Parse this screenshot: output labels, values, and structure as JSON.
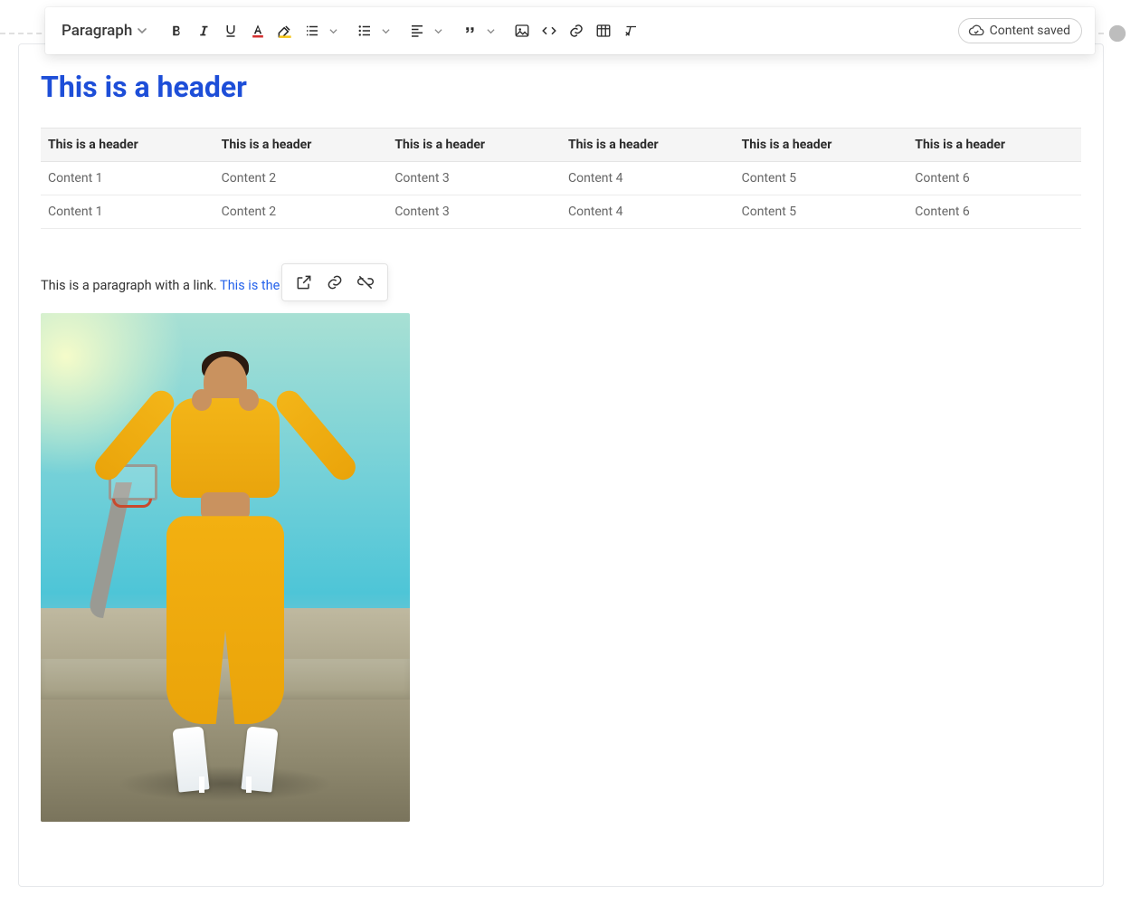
{
  "toolbar": {
    "block_type": "Paragraph",
    "saved_label": "Content saved"
  },
  "document": {
    "heading": "This is a header",
    "paragraph_prefix": "This is a paragraph with a link. ",
    "link_text": "This is the link."
  },
  "table": {
    "headers": [
      "This is a header",
      "This is a header",
      "This is a header",
      "This is a header",
      "This is a header",
      "This is a header"
    ],
    "rows": [
      [
        "Content 1",
        "Content 2",
        "Content 3",
        "Content 4",
        "Content 5",
        "Content 6"
      ],
      [
        "Content 1",
        "Content 2",
        "Content 3",
        "Content 4",
        "Content 5",
        "Content 6"
      ]
    ]
  },
  "image": {
    "alt": "embedded-photo"
  }
}
